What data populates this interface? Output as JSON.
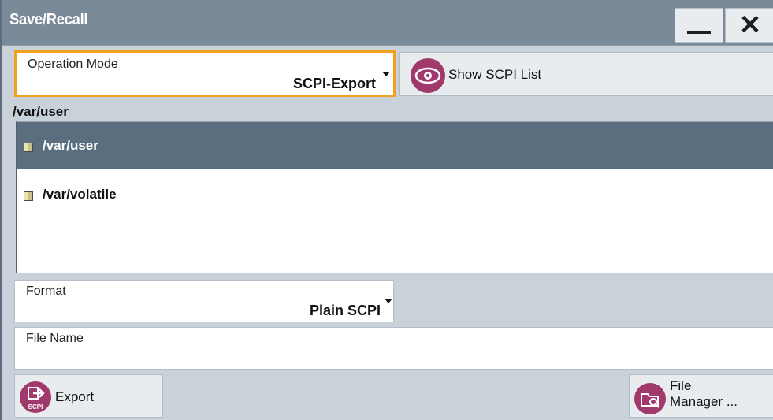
{
  "window": {
    "title": "Save/Recall",
    "minimize_icon": "minimize-icon",
    "close_icon": "close-icon"
  },
  "operation_mode": {
    "label": "Operation Mode",
    "value": "SCPI-Export"
  },
  "show_scpi_button": {
    "label": "Show SCPI List",
    "icon": "eye-icon"
  },
  "current_path": "/var/user",
  "directories": [
    {
      "name": "/var/user",
      "selected": true,
      "icon": "folder-icon"
    },
    {
      "name": "/var/volatile",
      "selected": false,
      "icon": "folder-icon"
    }
  ],
  "format": {
    "label": "Format",
    "value": "Plain SCPI"
  },
  "file_name": {
    "label": "File Name",
    "value": ""
  },
  "export_button": {
    "label": "Export",
    "icon": "scpi-export-icon",
    "icon_text": "SCPI"
  },
  "file_manager_button": {
    "label_line1": "File",
    "label_line2": "Manager ...",
    "icon": "file-manager-icon"
  },
  "colors": {
    "titlebar": "#7b8a99",
    "focus_border": "#f0a11d",
    "selected_row": "#5b6e80",
    "icon_accent": "#a03a6c"
  }
}
